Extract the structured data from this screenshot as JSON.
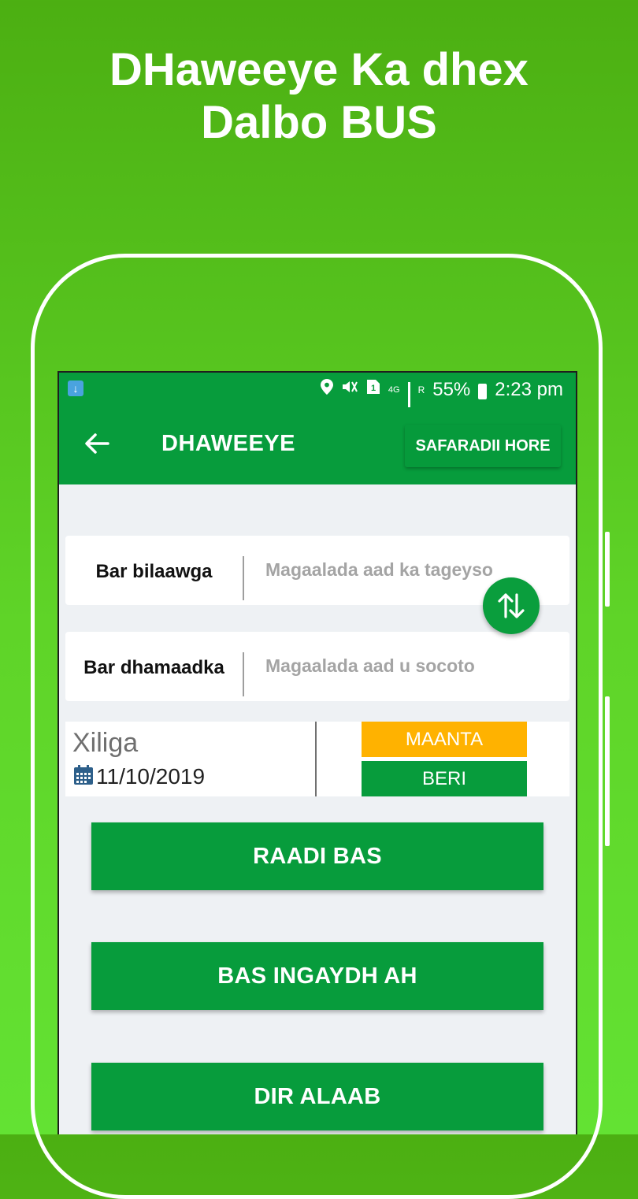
{
  "promo": {
    "line1": "DHaweeye Ka dhex",
    "line2": "Dalbo BUS"
  },
  "statusbar": {
    "network": "4G",
    "sim_slot": "1",
    "roaming": "R",
    "battery": "55%",
    "time": "2:23 pm"
  },
  "appbar": {
    "title": "DHAWEEYE",
    "history_button": "SAFARADII HORE"
  },
  "form": {
    "from_label": "Bar bilaawga",
    "from_placeholder": "Magaalada aad ka tageyso",
    "to_label": "Bar dhamaadka",
    "to_placeholder": "Magaalada aad u socoto"
  },
  "date": {
    "label": "Xiliga",
    "value": "11/10/2019",
    "today_label": "MAANTA",
    "tomorrow_label": "BERI"
  },
  "actions": {
    "search_bus": "RAADI BAS",
    "express_bus": "BAS INGAYDH AH",
    "send_cargo": "DIR ALAAB"
  },
  "colors": {
    "primary_green": "#079c3c",
    "today_orange": "#ffb200",
    "background": "#eef1f4"
  }
}
